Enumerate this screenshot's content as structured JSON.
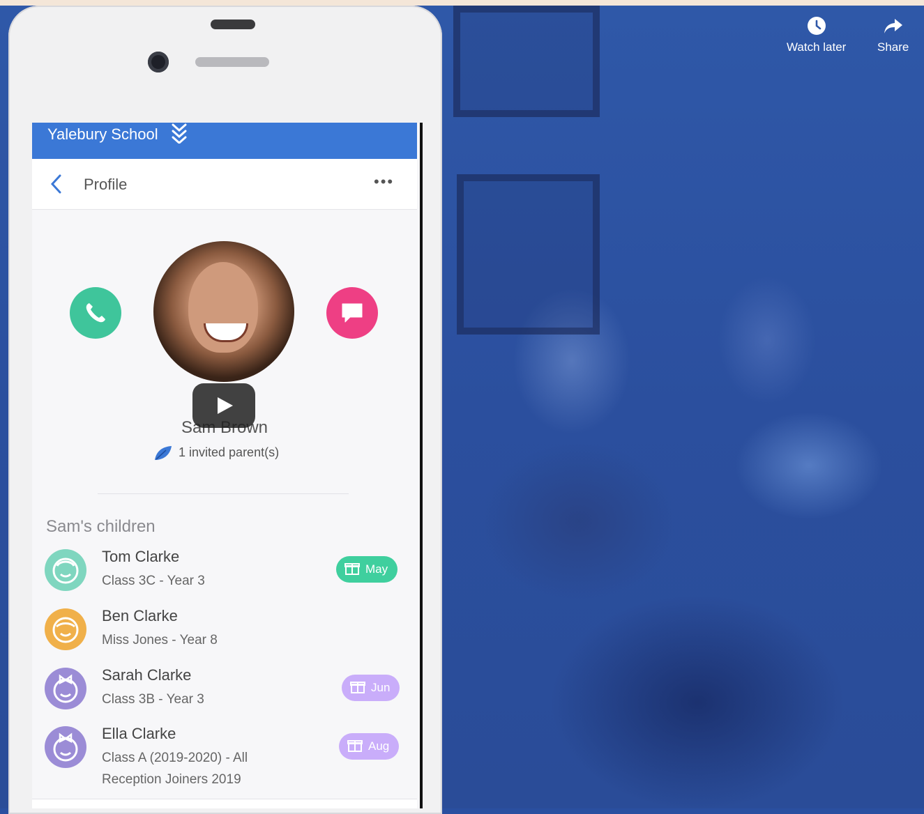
{
  "video_overlay": {
    "actions": [
      {
        "label": "Watch later",
        "icon": "clock-icon"
      },
      {
        "label": "Share",
        "icon": "share-arrow-icon"
      }
    ],
    "play_icon": "play-icon"
  },
  "app": {
    "school_name": "Yalebury School",
    "switch_icon": "double-chevron-down-icon",
    "nav": {
      "back_icon": "chevron-left-icon",
      "title": "Profile",
      "more_label": "•••"
    },
    "profile": {
      "name": "Sam Brown",
      "invited_text": "1 invited parent(s)",
      "invited_icon": "leaf-icon"
    },
    "children_heading": "Sam's children",
    "children": [
      {
        "name": "Tom Clarke",
        "class": "Class 3C - Year 3",
        "badge": "May",
        "color": "#3fcf9e",
        "avatar_color": "#7fd6bf"
      },
      {
        "name": "Ben Clarke",
        "class": "Miss Jones - Year 8",
        "badge": "",
        "color": "",
        "avatar_color": "#f0b04a"
      },
      {
        "name": "Sarah Clarke",
        "class": "Class 3B - Year 3",
        "badge": "Jun",
        "color": "#c9adfa",
        "avatar_color": "#9b8cd6"
      },
      {
        "name": "Ella Clarke",
        "class_line1": "Class A (2019-2020) - All",
        "class_line2": "Reception Joiners 2019",
        "badge": "Aug",
        "color": "#c9adfa",
        "avatar_color": "#9b8cd6"
      }
    ]
  },
  "colors": {
    "school_bar": "#3b78d6",
    "call_button": "#3fc59b",
    "message_button": "#ee3f84",
    "background_overlay": "#2a4fa0"
  }
}
